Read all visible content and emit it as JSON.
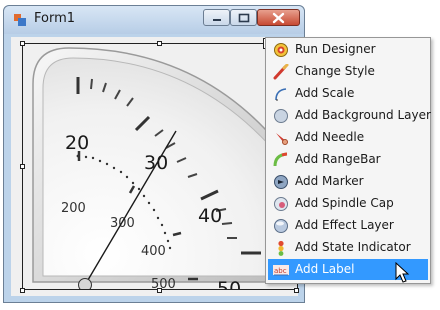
{
  "window": {
    "title": "Form1"
  },
  "gauge": {
    "scale_outer": [
      "20",
      "30",
      "40",
      "50"
    ],
    "scale_inner": [
      "200",
      "300",
      "400",
      "500"
    ]
  },
  "context_menu": {
    "items": [
      {
        "label": "Run Designer",
        "icon": "run-designer-icon"
      },
      {
        "label": "Change Style",
        "icon": "change-style-icon"
      },
      {
        "label": "Add Scale",
        "icon": "scale-icon"
      },
      {
        "label": "Add Background Layer",
        "icon": "background-layer-icon"
      },
      {
        "label": "Add Needle",
        "icon": "needle-icon"
      },
      {
        "label": "Add RangeBar",
        "icon": "rangebar-icon"
      },
      {
        "label": "Add Marker",
        "icon": "marker-icon"
      },
      {
        "label": "Add Spindle Cap",
        "icon": "spindle-cap-icon"
      },
      {
        "label": "Add Effect Layer",
        "icon": "effect-layer-icon"
      },
      {
        "label": "Add State Indicator",
        "icon": "state-indicator-icon"
      },
      {
        "label": "Add Label",
        "icon": "label-icon"
      }
    ],
    "highlighted_index": 10,
    "highlight_color": "#3399ff"
  }
}
